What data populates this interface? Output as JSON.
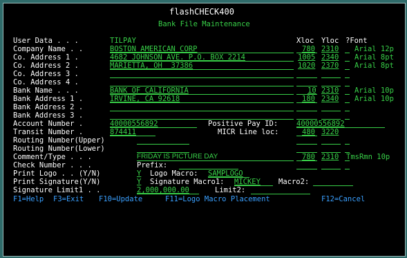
{
  "header": {
    "title": "flashCHECK400",
    "subtitle": "Bank File Maintenance"
  },
  "columns": {
    "xloc": "Xloc",
    "yloc": "Yloc",
    "font": "?Font"
  },
  "fields": [
    {
      "label": "User Data . . .",
      "value": "TILPAY"
    },
    {
      "label": "Company Name . .",
      "value": "BOSTON AMERICAN CORP",
      "xloc": "780",
      "yloc": "2310",
      "font": "Arial 12p"
    },
    {
      "label": "Co. Address 1 .",
      "value": "4682 JOHNSON AVE. P.O. BOX 2214",
      "xloc": "1005",
      "yloc": "2340",
      "font": "Arial 8pt"
    },
    {
      "label": "Co. Address 2 .",
      "value": "MARIETTA, OH  37386",
      "xloc": "1020",
      "yloc": "2370",
      "font": "Arial 8pt"
    },
    {
      "label": "Co. Address 3 .",
      "value": ""
    },
    {
      "label": "Co. Address 4 .",
      "value": ""
    },
    {
      "label": "Bank Name . . .",
      "value": "BANK OF CALIFORNIA",
      "xloc": "10",
      "yloc": "2310",
      "font": "Arial 10p"
    },
    {
      "label": "Bank Address 1 .",
      "value": "IRVINE, CA 92618",
      "xloc": "180",
      "yloc": "2340",
      "font": "Arial 10p"
    },
    {
      "label": "Bank Address 2 .",
      "value": ""
    },
    {
      "label": "Bank Address 3 .",
      "value": ""
    }
  ],
  "account": {
    "label": "Account Number .",
    "value": "40000556892",
    "pos_label": "Positive Pay ID:",
    "pos_value": "40000556892"
  },
  "transit": {
    "label": "Transit Number .",
    "value": "874411",
    "micr_label": "MICR Line loc:",
    "micr_x": "480",
    "micr_y": "3220"
  },
  "routing_upper": {
    "label": "Routing Number(Upper)"
  },
  "routing_lower": {
    "label": "Routing Number(Lower)"
  },
  "comment": {
    "label": "Comment/Type . . .",
    "value": "FRIDAY IS PICTURE DAY",
    "xloc": "780",
    "yloc": "2310",
    "font": "TmsRmn 10p"
  },
  "check_number": {
    "label": "Check Number . . .",
    "prefix_label": "Prefix:"
  },
  "print_logo": {
    "label": "Print Logo . . (Y/N)",
    "value": "Y",
    "macro_label": "Logo Macro:",
    "macro_value": "SAMPLOGO"
  },
  "print_sig": {
    "label": "Print Signature(Y/N)",
    "value": "Y",
    "macro1_label": "Signature Macro1:",
    "macro1_value": "MICKEY",
    "macro2_label": "Macro2:"
  },
  "sig_limit": {
    "label": "Signature Limit1 . .",
    "value": "2,000,000.00",
    "limit2_label": "Limit2:"
  },
  "fkeys": {
    "f1": "F1=Help",
    "f3": "F3=Exit",
    "f10": "F10=Update",
    "f11": "F11=Logo Macro Placement",
    "f12": "F12=Cancel"
  }
}
